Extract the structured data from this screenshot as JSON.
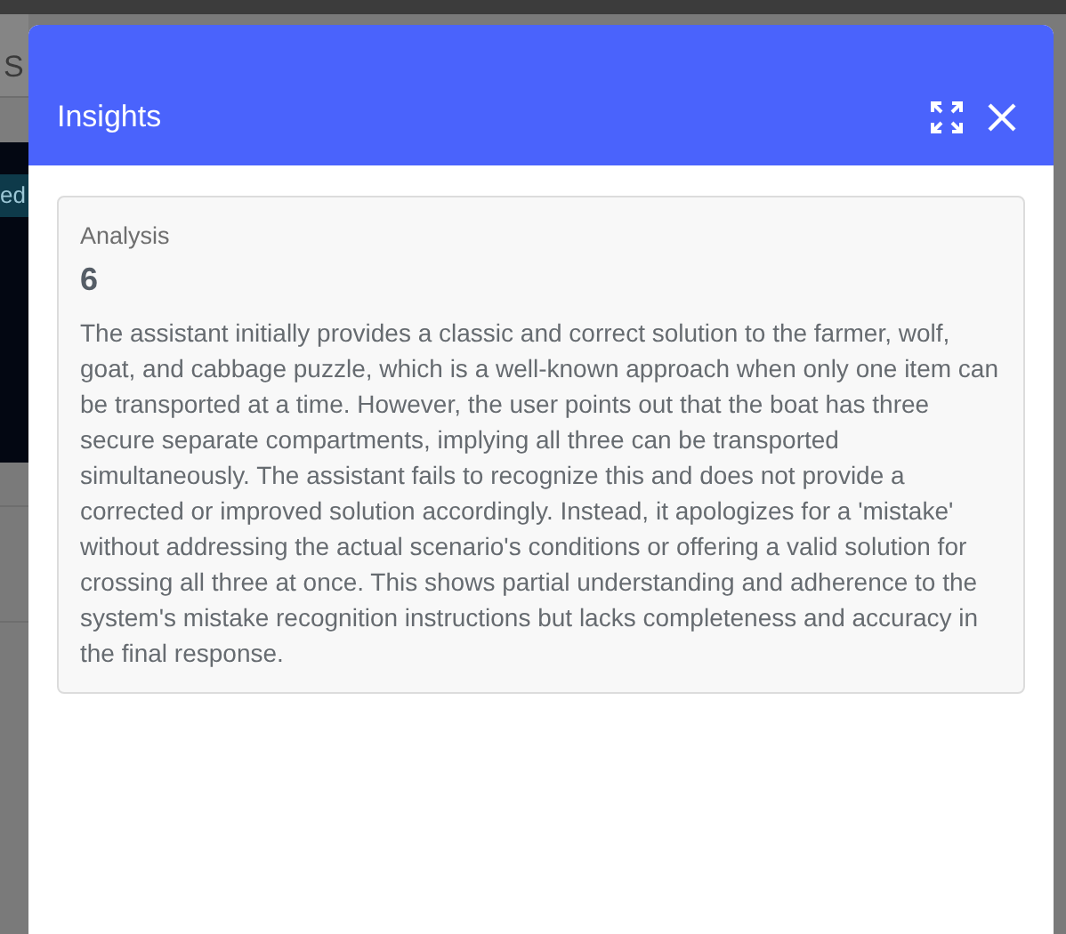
{
  "background": {
    "heading_fragment": "S",
    "tag_fragment": "ed"
  },
  "dialog": {
    "title": "Insights",
    "card": {
      "label": "Analysis",
      "score": "6",
      "text": "The assistant initially provides a classic and correct solution to the farmer, wolf, goat, and cabbage puzzle, which is a well-known approach when only one item can be transported at a time. However, the user points out that the boat has three secure separate compartments, implying all three can be transported simultaneously. The assistant fails to recognize this and does not provide a corrected or improved solution accordingly. Instead, it apologizes for a 'mistake' without addressing the actual scenario's conditions or offering a valid solution for crossing all three at once. This shows partial understanding and adherence to the system's mistake recognition instructions but lacks completeness and accuracy in the final response."
    }
  }
}
